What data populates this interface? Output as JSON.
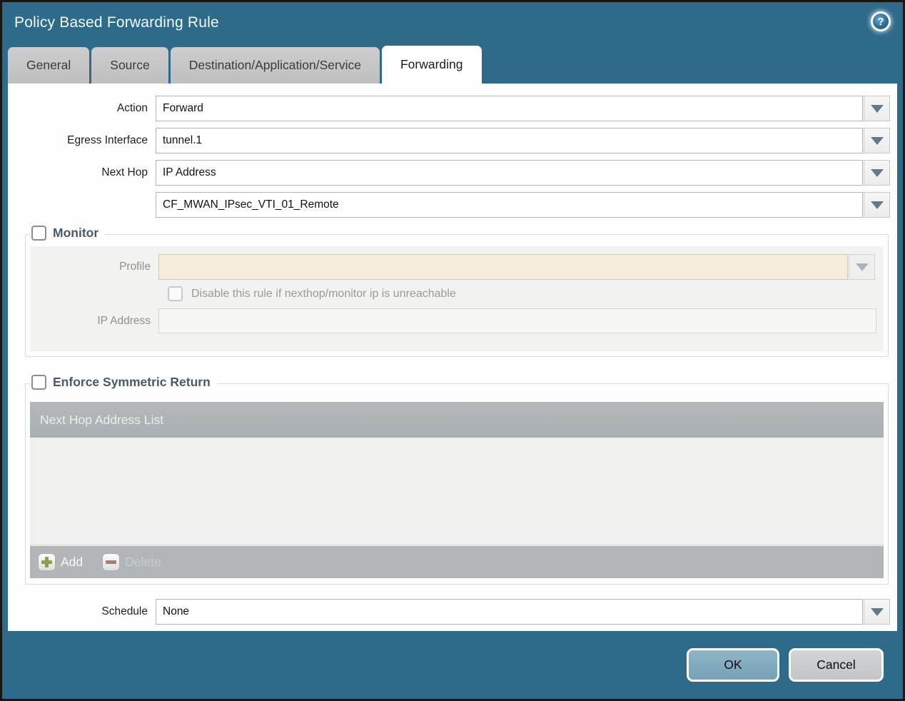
{
  "window": {
    "title": "Policy Based Forwarding Rule"
  },
  "icons": {
    "help_glyph": "?"
  },
  "tabs": [
    {
      "label": "General",
      "active": false
    },
    {
      "label": "Source",
      "active": false
    },
    {
      "label": "Destination/Application/Service",
      "active": false
    },
    {
      "label": "Forwarding",
      "active": true
    }
  ],
  "form": {
    "action": {
      "label": "Action",
      "value": "Forward"
    },
    "egress_interface": {
      "label": "Egress Interface",
      "value": "tunnel.1"
    },
    "next_hop": {
      "label": "Next Hop",
      "value": "IP Address"
    },
    "next_hop_address": {
      "value": "CF_MWAN_IPsec_VTI_01_Remote"
    },
    "schedule": {
      "label": "Schedule",
      "value": "None"
    }
  },
  "monitor": {
    "title": "Monitor",
    "checked": false,
    "profile": {
      "label": "Profile",
      "value": ""
    },
    "disable_rule_checkbox": {
      "label": "Disable this rule if nexthop/monitor ip is unreachable",
      "checked": false
    },
    "ip_address": {
      "label": "IP Address",
      "value": ""
    }
  },
  "symmetric_return": {
    "title": "Enforce Symmetric Return",
    "checked": false,
    "table_header": "Next Hop Address List",
    "rows": [],
    "add_label": "Add",
    "delete_label": "Delete"
  },
  "footer": {
    "ok_label": "OK",
    "cancel_label": "Cancel"
  },
  "colors": {
    "frame_teal": "#2e6b8a",
    "active_tab": "#ffffff",
    "inactive_tab": "#c4c5c6",
    "disabled_field_cream": "#f5eedb",
    "table_header_gray": "#aeb3b6",
    "add_green": "#8ba043",
    "delete_red": "#b07a6c",
    "ok_button": "#7fa9be",
    "cancel_button": "#c9cbcf",
    "section_title": "#485a6c"
  }
}
